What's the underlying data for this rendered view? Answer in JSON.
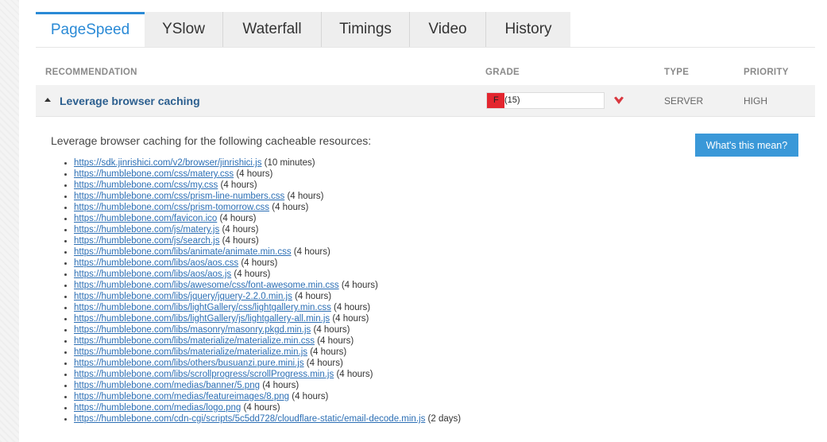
{
  "tabs": [
    {
      "label": "PageSpeed",
      "active": true
    },
    {
      "label": "YSlow",
      "active": false
    },
    {
      "label": "Waterfall",
      "active": false
    },
    {
      "label": "Timings",
      "active": false
    },
    {
      "label": "Video",
      "active": false
    },
    {
      "label": "History",
      "active": false
    }
  ],
  "table": {
    "headers": {
      "recommendation": "RECOMMENDATION",
      "grade": "GRADE",
      "type": "TYPE",
      "priority": "PRIORITY"
    },
    "row": {
      "title": "Leverage browser caching",
      "grade_letter": "F",
      "grade_score": "(15)",
      "grade_percent": 15,
      "grade_color": "#e3262f",
      "type": "SERVER",
      "priority": "HIGH",
      "expanded": true
    }
  },
  "details": {
    "intro": "Leverage browser caching for the following cacheable resources:",
    "button_label": "What's this mean?",
    "resources": [
      {
        "url": "https://sdk.jinrishici.com/v2/browser/jinrishici.js",
        "time": "(10 minutes)"
      },
      {
        "url": "https://humblebone.com/css/matery.css",
        "time": "(4 hours)"
      },
      {
        "url": "https://humblebone.com/css/my.css",
        "time": "(4 hours)"
      },
      {
        "url": "https://humblebone.com/css/prism-line-numbers.css",
        "time": "(4 hours)"
      },
      {
        "url": "https://humblebone.com/css/prism-tomorrow.css",
        "time": "(4 hours)"
      },
      {
        "url": "https://humblebone.com/favicon.ico",
        "time": "(4 hours)"
      },
      {
        "url": "https://humblebone.com/js/matery.js",
        "time": "(4 hours)"
      },
      {
        "url": "https://humblebone.com/js/search.js",
        "time": "(4 hours)"
      },
      {
        "url": "https://humblebone.com/libs/animate/animate.min.css",
        "time": "(4 hours)"
      },
      {
        "url": "https://humblebone.com/libs/aos/aos.css",
        "time": "(4 hours)"
      },
      {
        "url": "https://humblebone.com/libs/aos/aos.js",
        "time": "(4 hours)"
      },
      {
        "url": "https://humblebone.com/libs/awesome/css/font-awesome.min.css",
        "time": "(4 hours)"
      },
      {
        "url": "https://humblebone.com/libs/jquery/jquery-2.2.0.min.js",
        "time": "(4 hours)"
      },
      {
        "url": "https://humblebone.com/libs/lightGallery/css/lightgallery.min.css",
        "time": "(4 hours)"
      },
      {
        "url": "https://humblebone.com/libs/lightGallery/js/lightgallery-all.min.js",
        "time": "(4 hours)"
      },
      {
        "url": "https://humblebone.com/libs/masonry/masonry.pkgd.min.js",
        "time": "(4 hours)"
      },
      {
        "url": "https://humblebone.com/libs/materialize/materialize.min.css",
        "time": "(4 hours)"
      },
      {
        "url": "https://humblebone.com/libs/materialize/materialize.min.js",
        "time": "(4 hours)"
      },
      {
        "url": "https://humblebone.com/libs/others/busuanzi.pure.mini.js",
        "time": "(4 hours)"
      },
      {
        "url": "https://humblebone.com/libs/scrollprogress/scrollProgress.min.js",
        "time": "(4 hours)"
      },
      {
        "url": "https://humblebone.com/medias/banner/5.png",
        "time": "(4 hours)"
      },
      {
        "url": "https://humblebone.com/medias/featureimages/8.png",
        "time": "(4 hours)"
      },
      {
        "url": "https://humblebone.com/medias/logo.png",
        "time": "(4 hours)"
      },
      {
        "url": "https://humblebone.com/cdn-cgi/scripts/5c5dd728/cloudflare-static/email-decode.min.js",
        "time": "(2 days)"
      }
    ]
  },
  "colors": {
    "accent": "#2a8ad6",
    "link": "#2c6fb5",
    "title": "#2c5f8f",
    "button": "#3a98d8",
    "heart": "#d9373f"
  },
  "icons": {
    "toggle": "triangle-up-icon",
    "favorite": "heart-icon"
  }
}
